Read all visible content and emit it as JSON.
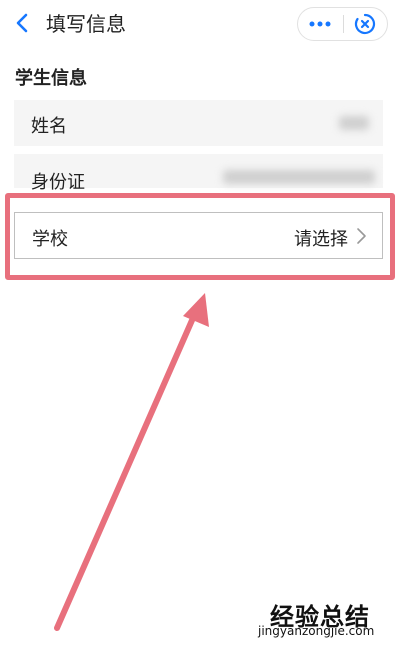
{
  "nav": {
    "title": "填写信息",
    "back_icon": "chevron-left-icon",
    "more_icon": "more-dots-icon",
    "close_icon": "close-circle-icon"
  },
  "section": {
    "title": "学生信息"
  },
  "form": {
    "name_label": "姓名",
    "id_label": "身份证",
    "school_label": "学校",
    "school_value": "请选择"
  },
  "colors": {
    "accent": "#1677ff",
    "highlight": "#e8707d",
    "row_bg": "#f5f5f5"
  },
  "watermark": {
    "main": "经验总结",
    "sub": "jingyanzongjie.com"
  }
}
